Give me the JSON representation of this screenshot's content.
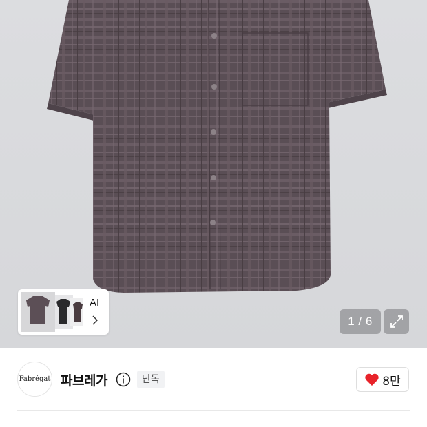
{
  "gallery": {
    "counter": "1 / 6",
    "ai_label": "AI",
    "expand_icon": "expand-icon",
    "chevron_icon": "chevron-right-icon"
  },
  "brand": {
    "logo_text": "Fabrégat",
    "name": "파브레가",
    "info_icon": "info-icon",
    "badge": "단독"
  },
  "like": {
    "icon": "heart-icon",
    "color": "#e8232a",
    "count": "8만"
  }
}
